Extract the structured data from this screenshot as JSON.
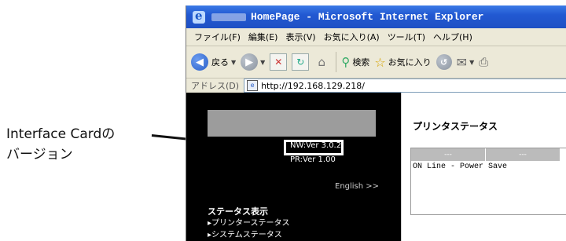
{
  "annotation": {
    "line1": "Interface Cardの",
    "line2": "バージョン"
  },
  "window": {
    "title": "HomePage - Microsoft Internet Explorer"
  },
  "menu": [
    "ファイル(F)",
    "編集(E)",
    "表示(V)",
    "お気に入り(A)",
    "ツール(T)",
    "ヘルプ(H)"
  ],
  "toolbar": {
    "back_label": "戻る",
    "search_label": "検索",
    "favorites_label": "お気に入り"
  },
  "address": {
    "label": "アドレス(D)",
    "url": "http://192.168.129.218/"
  },
  "left_panel": {
    "nw_version": "NW:Ver 3.0.2",
    "pr_version": "PR:Ver 1.00",
    "english_link": "English >>",
    "status_heading": "ステータス表示",
    "printer_status_link": "▸プリンターステータス",
    "system_status_link": "▸システムステータス"
  },
  "main": {
    "title": "プリンタステータス",
    "table_headers": [
      "---",
      "---"
    ],
    "status_text": "ON Line - Power Save"
  }
}
